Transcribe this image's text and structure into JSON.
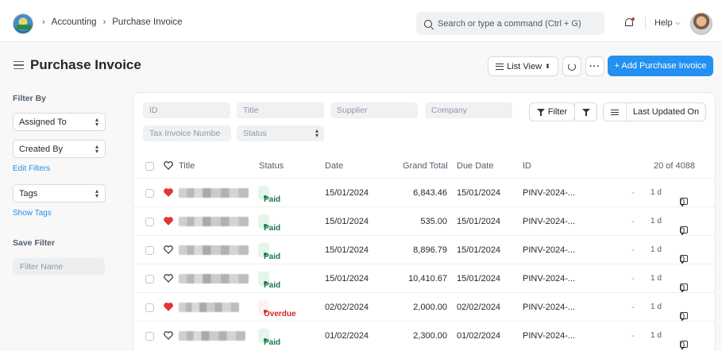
{
  "navbar": {
    "breadcrumbs": [
      "Accounting",
      "Purchase Invoice"
    ],
    "search_placeholder": "Search or type a command (Ctrl + G)",
    "help_label": "Help"
  },
  "page": {
    "title": "Purchase Invoice",
    "list_view_label": "List View",
    "more_label": "···",
    "add_button_label": "+ Add Purchase Invoice"
  },
  "sidebar": {
    "filter_by_label": "Filter By",
    "assigned_to_label": "Assigned To",
    "created_by_label": "Created By",
    "edit_filters_label": "Edit Filters",
    "tags_label": "Tags",
    "show_tags_label": "Show Tags",
    "save_filter_label": "Save Filter",
    "filter_name_placeholder": "Filter Name"
  },
  "filters": {
    "id_placeholder": "ID",
    "title_placeholder": "Title",
    "supplier_placeholder": "Supplier",
    "company_placeholder": "Company",
    "tax_invoice_placeholder": "Tax Invoice Numbe",
    "status_placeholder": "Status",
    "filter_button_label": "Filter",
    "sort_label": "Last Updated On"
  },
  "table": {
    "headers": {
      "title": "Title",
      "status": "Status",
      "date": "Date",
      "grand_total": "Grand Total",
      "due_date": "Due Date",
      "id": "ID",
      "count": "20 of 4088"
    },
    "rows": [
      {
        "liked": true,
        "status": "Paid",
        "status_kind": "paid",
        "date": "15/01/2024",
        "grand_total": "6,843.46",
        "due_date": "15/01/2024",
        "id": "PINV-2024-...",
        "dash": "-",
        "age": "1 d",
        "comments": "0"
      },
      {
        "liked": true,
        "status": "Paid",
        "status_kind": "paid",
        "date": "15/01/2024",
        "grand_total": "535.00",
        "due_date": "15/01/2024",
        "id": "PINV-2024-...",
        "dash": "-",
        "age": "1 d",
        "comments": "0"
      },
      {
        "liked": false,
        "status": "Paid",
        "status_kind": "paid",
        "date": "15/01/2024",
        "grand_total": "8,896.79",
        "due_date": "15/01/2024",
        "id": "PINV-2024-...",
        "dash": "-",
        "age": "1 d",
        "comments": "0"
      },
      {
        "liked": false,
        "status": "Paid",
        "status_kind": "paid",
        "date": "15/01/2024",
        "grand_total": "10,410.67",
        "due_date": "15/01/2024",
        "id": "PINV-2024-...",
        "dash": "-",
        "age": "1 d",
        "comments": "0"
      },
      {
        "liked": true,
        "status": "Overdue",
        "status_kind": "overdue",
        "date": "02/02/2024",
        "grand_total": "2,000.00",
        "due_date": "02/02/2024",
        "id": "PINV-2024-...",
        "dash": "-",
        "age": "1 d",
        "comments": "0"
      },
      {
        "liked": false,
        "status": "Paid",
        "status_kind": "paid",
        "date": "01/02/2024",
        "grand_total": "2,300.00",
        "due_date": "01/02/2024",
        "id": "PINV-2024-...",
        "dash": "-",
        "age": "1 d",
        "comments": "0"
      }
    ]
  },
  "colors": {
    "primary": "#2490ef",
    "heart_liked": "#e03636",
    "paid_text": "#16794c",
    "overdue_text": "#cc2929"
  }
}
